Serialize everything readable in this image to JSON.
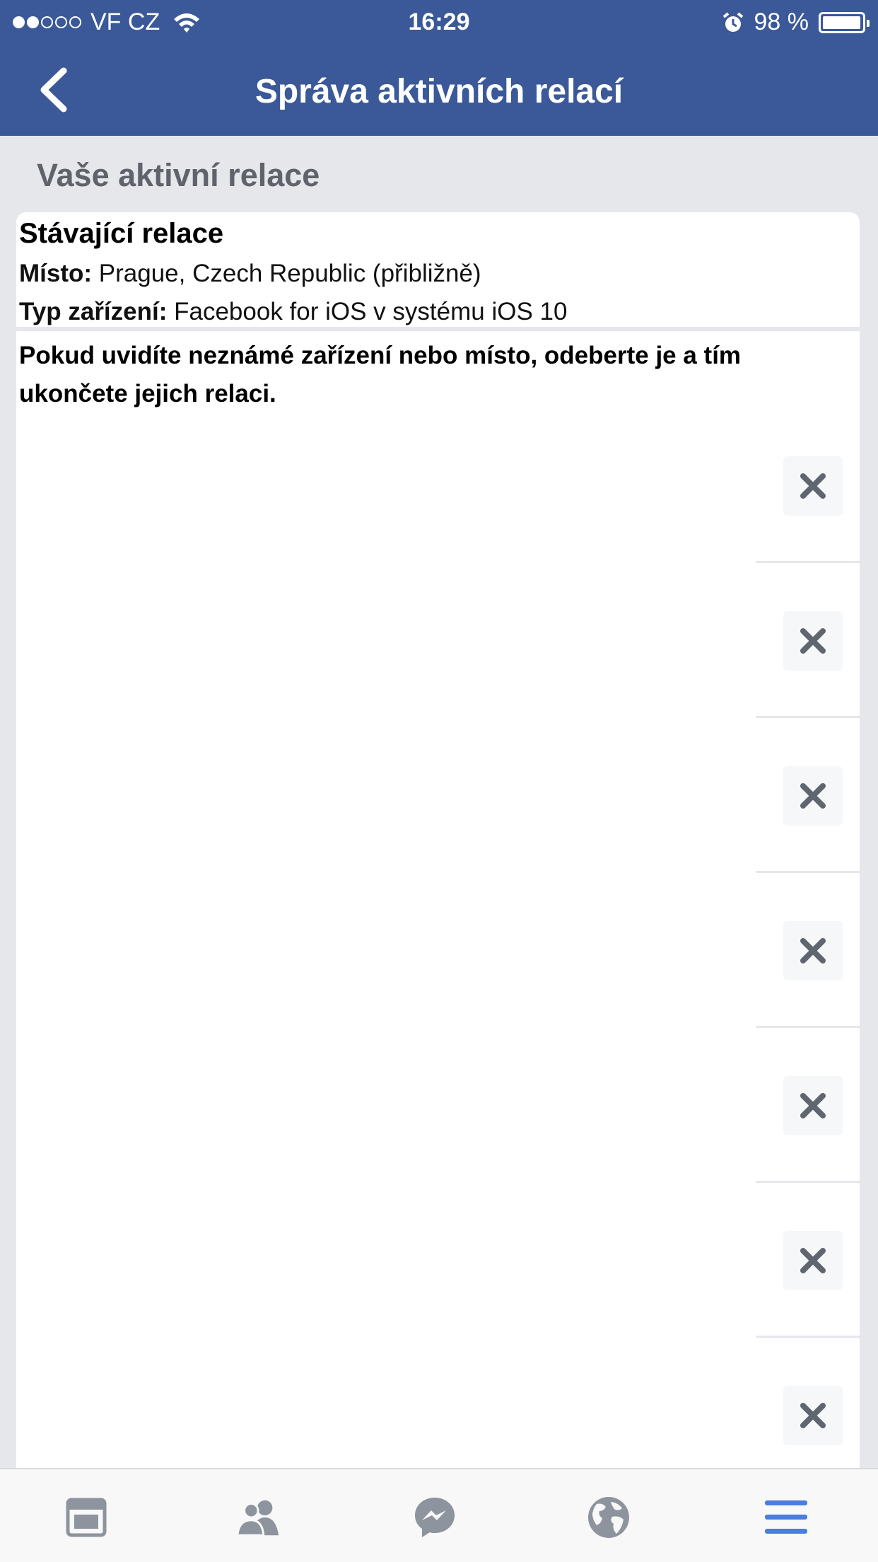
{
  "status_bar": {
    "carrier": "VF CZ",
    "signal_bars_filled": 2,
    "signal_bars_total": 5,
    "time": "16:29",
    "battery_percent": "98 %",
    "battery_level": 0.98
  },
  "navbar": {
    "title": "Správa aktivních relací",
    "back_icon": "chevron-left-icon"
  },
  "section_title": "Vaše aktivní relace",
  "current_session": {
    "heading": "Stávající relace",
    "location_label": "Místo:",
    "location_value": " Prague, Czech Republic (přibližně)",
    "device_label": "Typ zařízení:",
    "device_value": " Facebook for iOS v systému iOS 10"
  },
  "warning": "Pokud uvidíte neznámé zařízení nebo místo, odeberte je a tím ukončete jejich relaci.",
  "sessions": [
    {
      "remove_icon": "close-icon"
    },
    {
      "remove_icon": "close-icon"
    },
    {
      "remove_icon": "close-icon"
    },
    {
      "remove_icon": "close-icon"
    },
    {
      "remove_icon": "close-icon"
    },
    {
      "remove_icon": "close-icon"
    },
    {
      "remove_icon": "close-icon"
    }
  ],
  "tabbar": {
    "tabs": [
      {
        "icon": "news-feed-icon"
      },
      {
        "icon": "friends-icon"
      },
      {
        "icon": "messenger-icon"
      },
      {
        "icon": "globe-icon"
      },
      {
        "icon": "menu-icon",
        "active": true
      }
    ]
  },
  "colors": {
    "brand": "#3b5998",
    "tab_active": "#4a7ddf",
    "tab_inactive": "#8d949e"
  }
}
